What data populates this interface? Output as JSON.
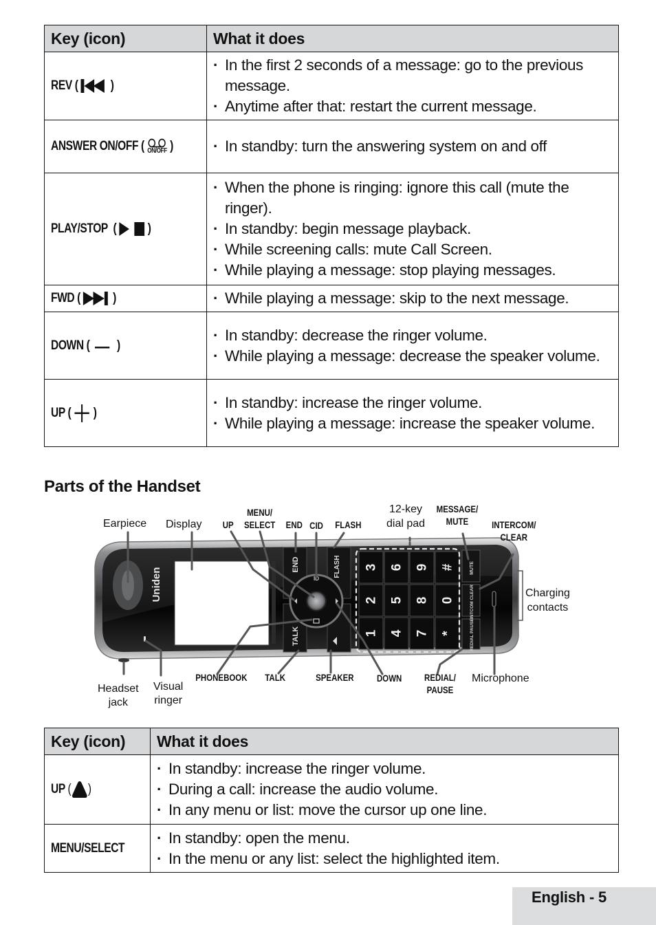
{
  "table1": {
    "headers": [
      "Key (icon)",
      "What it does"
    ],
    "rows": [
      {
        "key": "REV",
        "icon": "rewind-skip-back-icon",
        "bullets": [
          "In the first 2 seconds of a message: go to the previous message.",
          "Anytime after that: restart the current message."
        ]
      },
      {
        "key": "ANSWER ON/OFF",
        "icon": "answering-machine-tape-icon",
        "icon_caption": "ON/OFF",
        "bullets": [
          "In standby: turn the answering system on and off"
        ]
      },
      {
        "key": "PLAY/STOP",
        "icon": "play-stop-icon",
        "bullets": [
          "When the phone is ringing: ignore this call (mute the ringer).",
          "In standby: begin message playback.",
          "While screening calls: mute Call Screen.",
          "While playing a message: stop playing messages."
        ]
      },
      {
        "key": "FWD",
        "icon": "fast-forward-skip-icon",
        "bullets": [
          "While playing a message: skip to the next message."
        ]
      },
      {
        "key": "DOWN",
        "icon": "minus-icon",
        "bullets": [
          "In standby: decrease the ringer volume.",
          "While playing a message: decrease the speaker volume."
        ]
      },
      {
        "key": "UP",
        "icon": "plus-icon",
        "bullets": [
          "In standby: increase the ringer volume.",
          "While playing a message: increase the speaker volume."
        ]
      }
    ]
  },
  "section_title": "Parts of the Handset",
  "diagram": {
    "brand": "Uniden",
    "labels": {
      "earpiece": "Earpiece",
      "display": "Display",
      "up": "UP",
      "menu_select_1": "MENU/",
      "menu_select_2": "SELECT",
      "end": "END",
      "cid": "CID",
      "flash": "FLASH",
      "dialpad_1": "12-key",
      "dialpad_2": "dial pad",
      "message_mute_1": "MESSAGE/",
      "message_mute_2": "MUTE",
      "intercom_clear_1": "INTERCOM/",
      "intercom_clear_2": "CLEAR",
      "charging_1": "Charging",
      "charging_2": "contacts",
      "headset_1": "Headset",
      "headset_2": "jack",
      "visual_1": "Visual",
      "visual_2": "ringer",
      "phonebook": "PHONEBOOK",
      "talk": "TALK",
      "speaker": "SPEAKER",
      "down": "DOWN",
      "redial_1": "REDIAL/",
      "redial_2": "PAUSE",
      "microphone": "Microphone"
    },
    "keys": {
      "end": "END",
      "flash": "FLASH",
      "talk": "TALK",
      "cid": "ID",
      "digits": [
        [
          "3",
          "6",
          "9",
          "#"
        ],
        [
          "2",
          "5",
          "8",
          "0"
        ],
        [
          "1",
          "4",
          "7",
          "*"
        ]
      ],
      "side": [
        "MUTE",
        "INTCOM CLEAR",
        "REDIAL PAUSE"
      ]
    }
  },
  "table2": {
    "headers": [
      "Key (icon)",
      "What it does"
    ],
    "rows": [
      {
        "key": "UP",
        "icon": "up-triangle-icon",
        "bullets": [
          "In standby: increase the ringer volume.",
          "During a call: increase the audio volume.",
          "In any menu or list: move the cursor up one line."
        ]
      },
      {
        "key": "MENU/SELECT",
        "bullets": [
          "In standby: open the menu.",
          "In the menu or any list: select the highlighted item."
        ]
      }
    ]
  },
  "footer": {
    "page_label": "English - 5"
  }
}
